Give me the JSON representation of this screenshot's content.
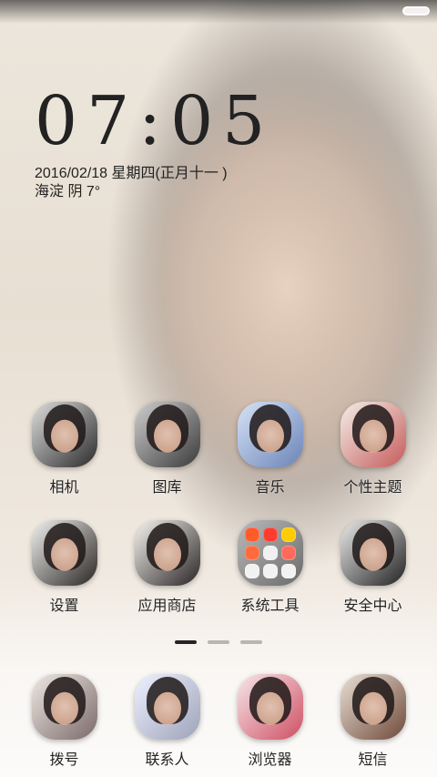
{
  "lockscreen": {
    "time": "07:05",
    "date": "2016/02/18  星期四(正月十一 )",
    "weather": "海淀 阴 7°"
  },
  "home": {
    "apps_row1": [
      {
        "label": "相机",
        "icon": "camera-icon",
        "colors": [
          "#2b2b2b",
          "#dedede"
        ]
      },
      {
        "label": "图库",
        "icon": "gallery-icon",
        "colors": [
          "#3a3a3a",
          "#cfcfcf"
        ]
      },
      {
        "label": "音乐",
        "icon": "music-icon",
        "colors": [
          "#6b84b8",
          "#d6e2f6"
        ]
      },
      {
        "label": "个性主题",
        "icon": "theme-icon",
        "colors": [
          "#c55b5b",
          "#f4efe8"
        ]
      }
    ],
    "apps_row2": [
      {
        "label": "设置",
        "icon": "settings-icon",
        "colors": [
          "#2a2622",
          "#f1f1f1"
        ]
      },
      {
        "label": "应用商店",
        "icon": "app-store-icon",
        "colors": [
          "#2a2525",
          "#f7f4f0"
        ]
      },
      {
        "label": "系统工具",
        "icon": "system-tools-folder-icon",
        "colors": [
          "#6b6b6b",
          "#b9b9b9"
        ]
      },
      {
        "label": "安全中心",
        "icon": "security-center-icon",
        "colors": [
          "#222222",
          "#eaeaea"
        ]
      }
    ],
    "page_indicator": {
      "active_index": 0,
      "count": 3
    },
    "dock": [
      {
        "label": "拨号",
        "icon": "phone-icon",
        "colors": [
          "#7b6a6a",
          "#eee8e2"
        ]
      },
      {
        "label": "联系人",
        "icon": "contacts-icon",
        "colors": [
          "#9ea3b9",
          "#edf1ff"
        ]
      },
      {
        "label": "浏览器",
        "icon": "browser-icon",
        "colors": [
          "#cf4f62",
          "#f6e7ea"
        ]
      },
      {
        "label": "短信",
        "icon": "message-icon",
        "colors": [
          "#6f4a3a",
          "#eadfd6"
        ]
      }
    ]
  },
  "system_tools_folder": {
    "mini_icons": [
      {
        "name": "orange-app-icon",
        "color": "#ff5a2a"
      },
      {
        "name": "red-app-icon",
        "color": "#ff3b30"
      },
      {
        "name": "multicolor-app-icon",
        "color": "#ffcc00"
      },
      {
        "name": "camera-app-icon",
        "color": "#ff6a3d"
      },
      {
        "name": "photo-app-icon",
        "color": "#f0f0f0"
      },
      {
        "name": "nfc-app-icon",
        "color": "#ff6b5a"
      },
      {
        "name": "photo-app-icon-2",
        "color": "#f2f2f2"
      },
      {
        "name": "photo-app-icon-3",
        "color": "#f2f2f2"
      },
      {
        "name": "photo-app-icon-4",
        "color": "#f2f2f2"
      }
    ]
  }
}
